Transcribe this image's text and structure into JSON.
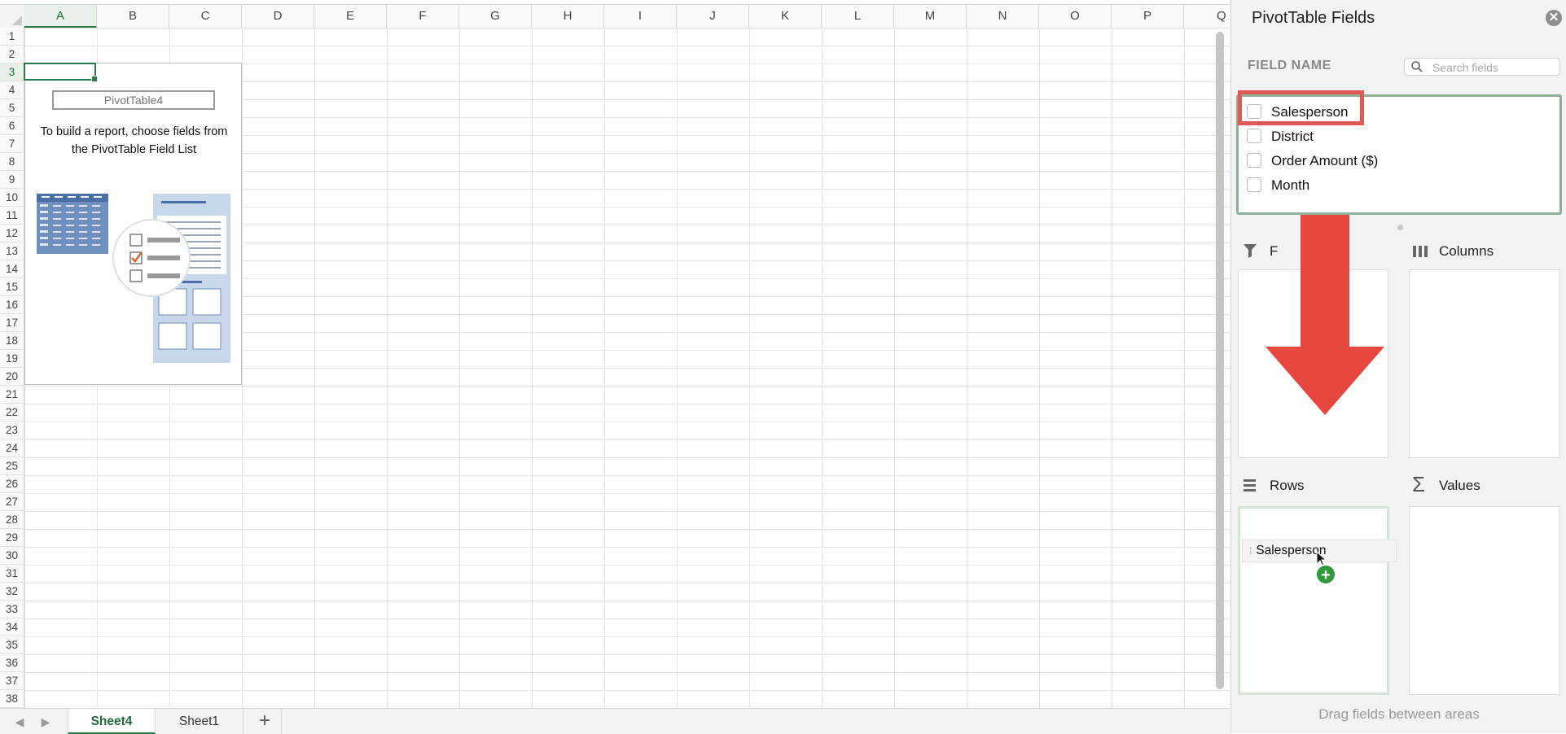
{
  "spreadsheet": {
    "columns": [
      "A",
      "B",
      "C",
      "D",
      "E",
      "F",
      "G",
      "H",
      "I",
      "J",
      "K",
      "L",
      "M",
      "N",
      "O",
      "P",
      "Q"
    ],
    "selected_column": "A",
    "rows": [
      "1",
      "2",
      "3",
      "4",
      "5",
      "6",
      "7",
      "8",
      "9",
      "10",
      "11",
      "12",
      "13",
      "14",
      "15",
      "16",
      "17",
      "18",
      "19",
      "20",
      "21",
      "22",
      "23",
      "24",
      "25",
      "26",
      "27",
      "28",
      "29",
      "30",
      "31",
      "32",
      "33",
      "34",
      "35",
      "36",
      "37",
      "38"
    ],
    "selected_row": "3",
    "pivot_placeholder": {
      "name": "PivotTable4",
      "message_line1": "To build a report, choose fields from",
      "message_line2": "the PivotTable Field List"
    },
    "sheet_tabs": [
      {
        "label": "Sheet4",
        "active": true
      },
      {
        "label": "Sheet1",
        "active": false
      }
    ],
    "add_sheet_label": "+",
    "accent_color": "#2b7a46"
  },
  "pane": {
    "title": "PivotTable Fields",
    "close_glyph": "✕",
    "field_name_header": "FIELD NAME",
    "search_placeholder": "Search fields",
    "fields": [
      {
        "label": "Salesperson",
        "checked": false
      },
      {
        "label": "District",
        "checked": false
      },
      {
        "label": "Order Amount ($)",
        "checked": false
      },
      {
        "label": "Month",
        "checked": false
      }
    ],
    "areas": {
      "filters_label": "F",
      "columns_label": "Columns",
      "rows_label": "Rows",
      "values_label": "Values"
    },
    "dragging_chip": "Salesperson",
    "drop_indicator": "+",
    "footer": "Drag fields between areas",
    "annotation_color": "#e8473f"
  }
}
